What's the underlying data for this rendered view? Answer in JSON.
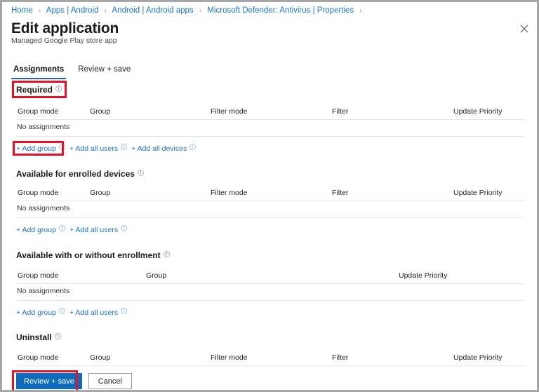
{
  "breadcrumb": {
    "items": [
      "Home",
      "Apps | Android",
      "Android | Android apps",
      "Microsoft Defender: Antivirus | Properties"
    ],
    "separator": "›"
  },
  "header": {
    "title": "Edit application",
    "subtitle": "Managed Google Play store app",
    "ellipsis": "···",
    "close_label": "Close"
  },
  "tabs": [
    {
      "label": "Assignments",
      "active": true
    },
    {
      "label": "Review + save",
      "active": false
    }
  ],
  "sections": [
    {
      "id": "required",
      "title": "Required",
      "columns": [
        "Group mode",
        "Group",
        "Filter mode",
        "Filter",
        "Update Priority"
      ],
      "empty_text": "No assignments",
      "links": [
        "+ Add group",
        "+ Add all users",
        "+ Add all devices"
      ]
    },
    {
      "id": "available-enrolled",
      "title": "Available for enrolled devices",
      "columns": [
        "Group mode",
        "Group",
        "Filter mode",
        "Filter",
        "Update Priority"
      ],
      "empty_text": "No assignments",
      "links": [
        "+ Add group",
        "+ Add all users"
      ]
    },
    {
      "id": "available-with-without",
      "title": "Available with or without enrollment",
      "columns": [
        "Group mode",
        "Group",
        "Update Priority"
      ],
      "empty_text": "No assignments",
      "links": [
        "+ Add group",
        "+ Add all users"
      ]
    },
    {
      "id": "uninstall",
      "title": "Uninstall",
      "columns": [
        "Group mode",
        "Group",
        "Filter mode",
        "Filter",
        "Update Priority"
      ],
      "empty_text": "",
      "links": []
    }
  ],
  "footer": {
    "primary_label": "Review + save",
    "secondary_label": "Cancel"
  },
  "colors": {
    "link": "#1a73c8",
    "primary_button": "#0f6cbd",
    "tab_underline": "#0f6cbd",
    "highlight_box": "#e81123"
  }
}
